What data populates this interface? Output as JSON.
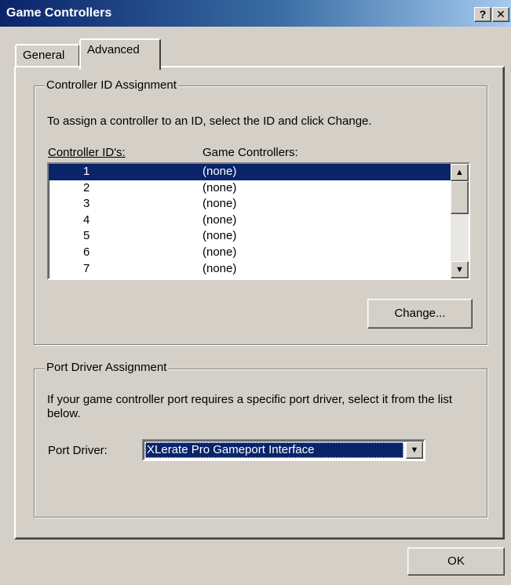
{
  "window": {
    "title": "Game Controllers",
    "help_glyph": "?",
    "close_glyph": "✕"
  },
  "tabs": [
    {
      "label": "General",
      "active": false
    },
    {
      "label": "Advanced",
      "active": true
    }
  ],
  "controller_id_group": {
    "legend": "Controller ID Assignment",
    "instructions": "To assign a controller to an ID, select the ID and click Change.",
    "col_id_label": "Controller ID's:",
    "col_gc_label": "Game Controllers:",
    "rows": [
      {
        "id": "1",
        "controller": "(none)",
        "selected": true
      },
      {
        "id": "2",
        "controller": "(none)"
      },
      {
        "id": "3",
        "controller": "(none)"
      },
      {
        "id": "4",
        "controller": "(none)"
      },
      {
        "id": "5",
        "controller": "(none)"
      },
      {
        "id": "6",
        "controller": "(none)"
      },
      {
        "id": "7",
        "controller": "(none)"
      }
    ],
    "change_button": "Change..."
  },
  "port_driver_group": {
    "legend": "Port Driver Assignment",
    "instructions": "If your game controller port requires a specific port driver, select it from the list below.",
    "port_driver_label": "Port Driver:",
    "selected_driver": "XLerate Pro Gameport Interface"
  },
  "footer": {
    "ok_button": "OK"
  },
  "colors": {
    "selection": "#0a246a",
    "face": "#d4d0c8"
  },
  "icons": {
    "scroll_up": "up-arrow-icon",
    "scroll_down": "down-arrow-icon",
    "dropdown": "chevron-down-icon"
  }
}
